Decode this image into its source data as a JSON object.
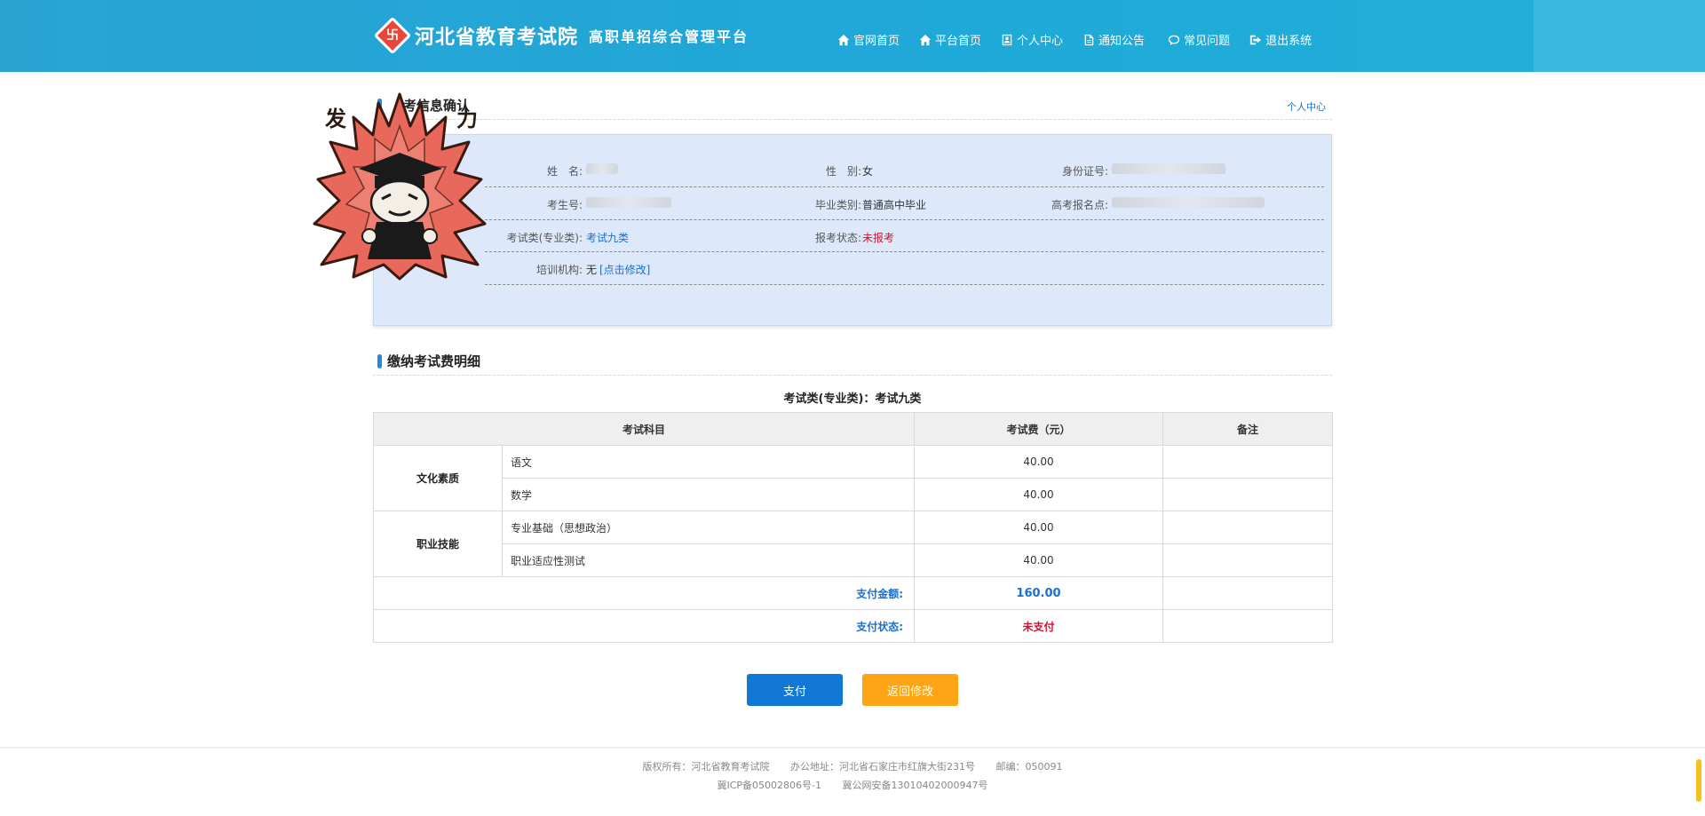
{
  "header": {
    "logo_glyph": "卐",
    "title": "河北省教育考试院",
    "subtitle": "高职单招综合管理平台",
    "nav": [
      {
        "label": "官网首页",
        "icon": "home-icon"
      },
      {
        "label": "平台首页",
        "icon": "home-icon"
      },
      {
        "label": "个人中心",
        "icon": "user-card-icon"
      },
      {
        "label": "通知公告",
        "icon": "document-icon"
      },
      {
        "label": "常见问题",
        "icon": "chat-bubble-icon"
      },
      {
        "label": "退出系统",
        "icon": "logout-icon"
      }
    ]
  },
  "info_section": {
    "title": "考信息确认",
    "right_link": "个人中心",
    "fields": {
      "name_label": "姓　名:",
      "gender_label": "性　别:",
      "gender_value": "女",
      "id_label": "身份证号:",
      "exam_no_label": "考生号:",
      "grad_type_label": "毕业类别:",
      "grad_type_value": "普通高中毕业",
      "reg_site_label": "高考报名点:",
      "exam_cat_label": "考试类(专业类):",
      "exam_cat_value": "考试九类",
      "reg_status_label": "报考状态:",
      "reg_status_value": "未报考",
      "training_label": "培训机构:",
      "training_value": "无",
      "training_edit": "[点击修改]"
    }
  },
  "mascot": {
    "left_text": "发",
    "right_text": "力"
  },
  "fee_section": {
    "title": "缴纳考试费明细",
    "caption": "考试类(专业类)：考试九类",
    "headers": {
      "subject": "考试科目",
      "fee": "考试费（元）",
      "remark": "备注"
    },
    "groups": [
      {
        "category": "文化素质",
        "items": [
          {
            "name": "语文",
            "fee": "40.00"
          },
          {
            "name": "数学",
            "fee": "40.00"
          }
        ]
      },
      {
        "category": "职业技能",
        "items": [
          {
            "name": "专业基础（思想政治）",
            "fee": "40.00"
          },
          {
            "name": "职业适应性测试",
            "fee": "40.00"
          }
        ]
      }
    ],
    "pay_amount_label": "支付金额:",
    "pay_amount": "160.00",
    "pay_status_label": "支付状态:",
    "pay_status": "未支付"
  },
  "buttons": {
    "pay": "支付",
    "back": "返回修改"
  },
  "footer": {
    "copyright": "版权所有：河北省教育考试院",
    "address": "办公地址：河北省石家庄市红旗大街231号",
    "postcode": "邮编：050091",
    "icp": "冀ICP备05002806号-1",
    "police": "冀公网安备13010402000947号"
  },
  "colors": {
    "header": "#20a8d8",
    "accent_blue": "#1278d6",
    "warn_red": "#d0122f",
    "back_btn": "#fea515"
  }
}
